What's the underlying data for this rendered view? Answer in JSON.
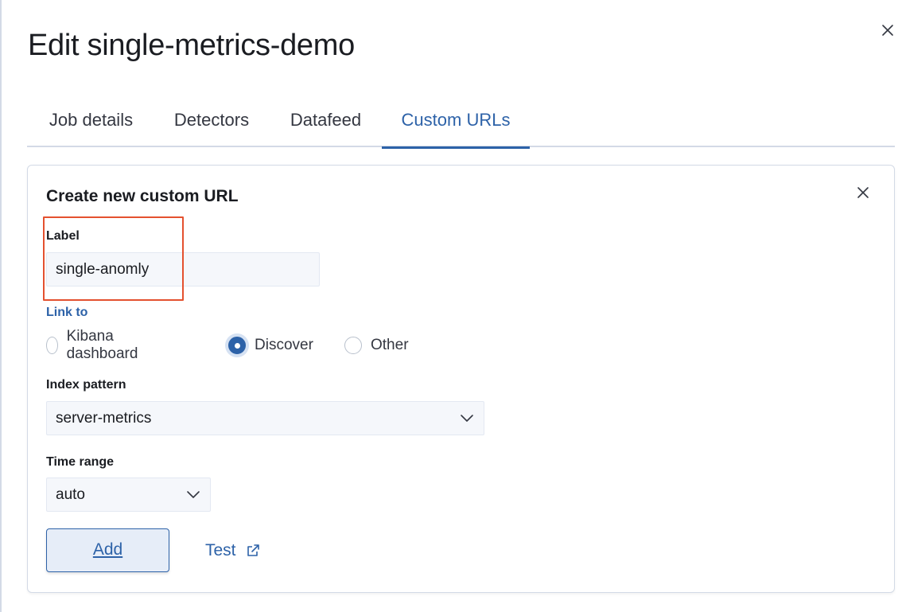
{
  "flyout": {
    "title": "Edit single-metrics-demo",
    "close_icon": "close-icon"
  },
  "tabs": [
    {
      "label": "Job details",
      "selected": false
    },
    {
      "label": "Detectors",
      "selected": false
    },
    {
      "label": "Datafeed",
      "selected": false
    },
    {
      "label": "Custom URLs",
      "selected": true
    }
  ],
  "panel": {
    "title": "Create new custom URL",
    "close_icon": "close-icon",
    "label_field": {
      "label": "Label",
      "value": "single-anomly"
    },
    "link_to": {
      "label": "Link to",
      "options": [
        {
          "label": "Kibana dashboard",
          "checked": false
        },
        {
          "label": "Discover",
          "checked": true
        },
        {
          "label": "Other",
          "checked": false
        }
      ]
    },
    "index_pattern": {
      "label": "Index pattern",
      "value": "server-metrics"
    },
    "time_range": {
      "label": "Time range",
      "value": "auto"
    },
    "add_button": "Add",
    "test_link": "Test"
  },
  "colors": {
    "accent": "#2d62a8",
    "highlight": "#e4512f",
    "border": "#d3dae6",
    "input_bg": "#f5f7fb"
  }
}
